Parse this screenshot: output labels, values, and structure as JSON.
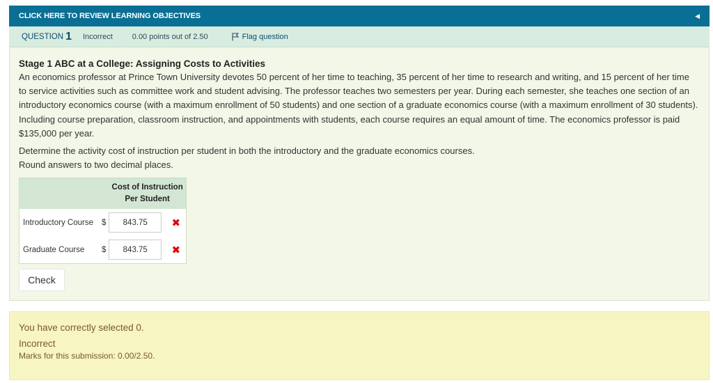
{
  "objectives": {
    "label": "CLICK HERE TO REVIEW LEARNING OBJECTIVES",
    "collapse_icon": "caret-left-icon"
  },
  "question_info": {
    "label": "QUESTION",
    "number": "1",
    "state": "Incorrect",
    "grade": "0.00 points out of 2.50",
    "flag": "Flag question"
  },
  "question": {
    "title": "Stage 1 ABC at a College: Assigning Costs to Activities",
    "paragraph1": "An economics professor at Prince Town University devotes 50 percent of her time to teaching, 35 percent of her time to research and writing, and 15 percent of her time to service activities such as committee work and student advising. The professor teaches two semesters per year. During each semester, she teaches one section of an introductory economics course (with a maximum enrollment of 50 students) and one section of a graduate economics course (with a maximum enrollment of 30 students). Including course preparation, classroom instruction, and appointments with students, each course requires an equal amount of time. The economics professor is paid $135,000 per year.",
    "paragraph2a": "Determine the activity cost of instruction per student in both the introductory and the graduate economics courses.",
    "paragraph2b": "Round answers to two decimal places."
  },
  "answer_table": {
    "header_line1": "Cost of Instruction",
    "header_line2": "Per Student",
    "rows": [
      {
        "label": "Introductory Course",
        "currency": "$",
        "value": "843.75",
        "mark": "✖"
      },
      {
        "label": "Graduate Course",
        "currency": "$",
        "value": "843.75",
        "mark": "✖"
      }
    ]
  },
  "check_button": "Check",
  "feedback": {
    "selected": "You have correctly selected 0.",
    "state": "Incorrect",
    "marks": "Marks for this submission: 0.00/2.50."
  }
}
